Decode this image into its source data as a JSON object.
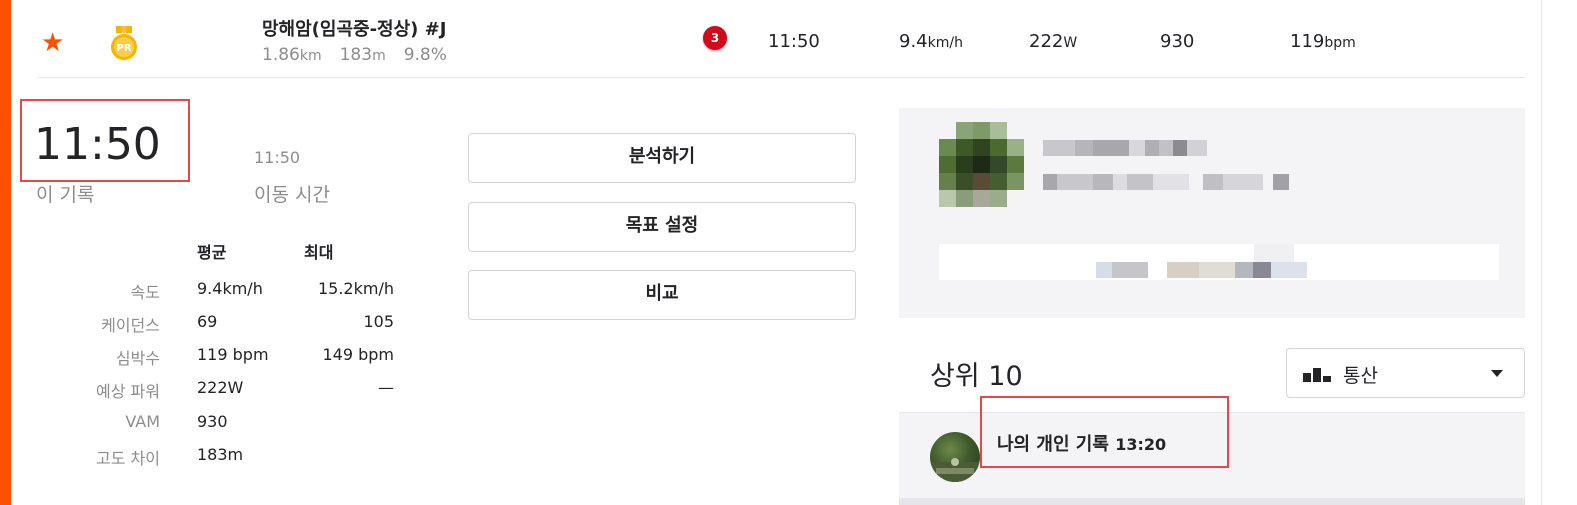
{
  "segment": {
    "star_icon": "star-icon",
    "medal_icon": "pr-medal-icon",
    "medal_text": "PR",
    "name": "망해암(임곡중-정상) #J",
    "distance": "1.86",
    "distance_unit": "km",
    "elevation": "183",
    "elevation_unit": "m",
    "grade": "9.8%",
    "rank": "3",
    "time": "11:50",
    "speed": "9.4",
    "speed_unit": "km/h",
    "power": "222",
    "power_unit": "W",
    "vam": "930",
    "heart_rate": "119",
    "heart_rate_unit": "bpm"
  },
  "detail": {
    "elapsed_time": "11:50",
    "elapsed_label": "이 기록",
    "moving_time": "11:50",
    "moving_label": "이동 시간",
    "headers": {
      "avg": "평균",
      "max": "최대"
    },
    "rows": [
      {
        "label": "속도",
        "avg": "9.4km/h",
        "max": "15.2km/h"
      },
      {
        "label": "케이던스",
        "avg": "69",
        "max": "105"
      },
      {
        "label": "심박수",
        "avg": "119 bpm",
        "max": "149 bpm"
      },
      {
        "label": "예상 파워",
        "avg": "222W",
        "max": "—"
      },
      {
        "label": "VAM",
        "avg": "930",
        "max": ""
      },
      {
        "label": "고도 차이",
        "avg": "183m",
        "max": ""
      }
    ]
  },
  "actions": {
    "analyze": "분석하기",
    "goal": "목표 설정",
    "compare": "비교"
  },
  "leaderboard": {
    "title": "상위 10",
    "filter_label": "통산",
    "my_pr_label": "나의 개인 기록",
    "my_pr_time": "13:20"
  },
  "colors": {
    "brand": "#fc5200",
    "rank_badge": "#d1091b",
    "highlight_box": "#e8474a"
  }
}
